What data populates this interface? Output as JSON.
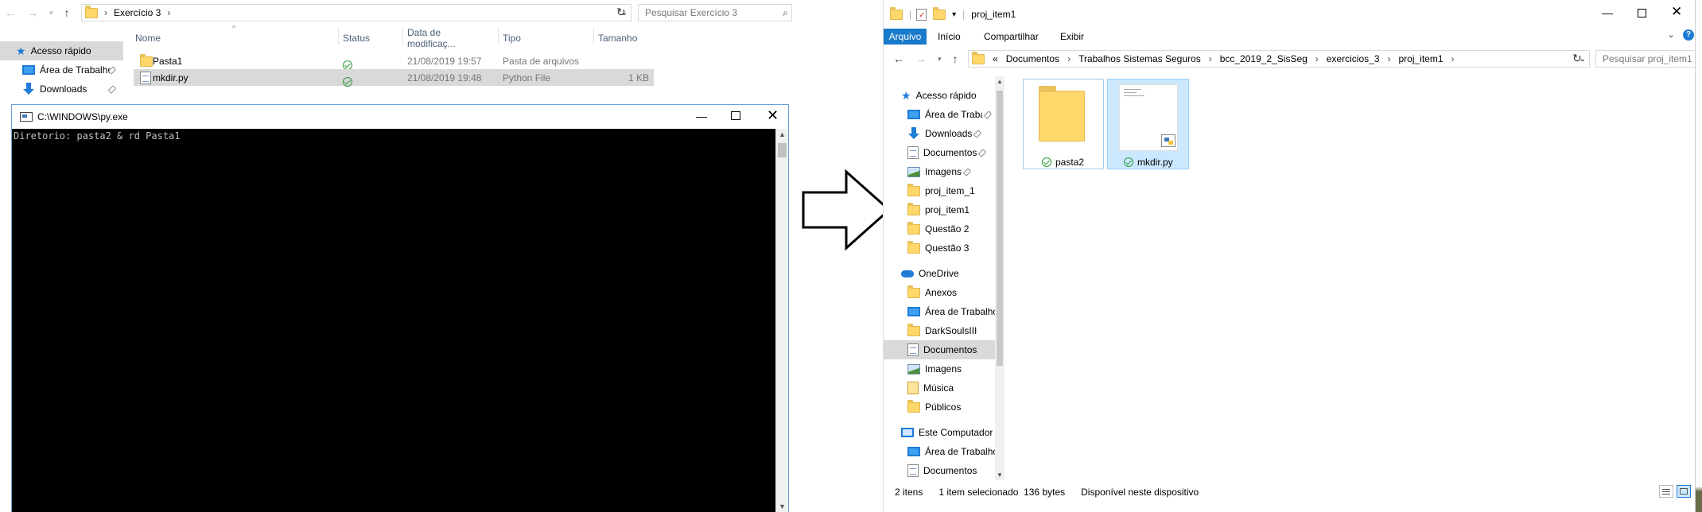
{
  "left_explorer": {
    "breadcrumb": [
      "Exercício 3"
    ],
    "search_placeholder": "Pesquisar Exercício 3",
    "columns": [
      "Nome",
      "Status",
      "Data de modificaç...",
      "Tipo",
      "Tamanho"
    ],
    "nav": [
      {
        "label": "Acesso rápido",
        "icon": "star-icon"
      },
      {
        "label": "Área de Trabalho",
        "icon": "desktop-icon"
      },
      {
        "label": "Downloads",
        "icon": "download-icon"
      }
    ],
    "files": [
      {
        "name": "Pasta1",
        "date": "21/08/2019 19:57",
        "type": "Pasta de arquivos",
        "size": ""
      },
      {
        "name": "mkdir.py",
        "date": "21/08/2019 19:48",
        "type": "Python File",
        "size": "1 KB"
      }
    ]
  },
  "console": {
    "title": "C:\\WINDOWS\\py.exe",
    "output": "Diretorio: pasta2 & rd Pasta1"
  },
  "right_explorer": {
    "title": "proj_item1",
    "ribbon_tabs": [
      "Arquivo",
      "Início",
      "Compartilhar",
      "Exibir"
    ],
    "breadcrumb": [
      "«",
      "Documentos",
      "Trabalhos Sistemas Seguros",
      "bcc_2019_2_SisSeg",
      "exercicios_3",
      "proj_item1"
    ],
    "search_placeholder": "Pesquisar proj_item1",
    "nav": [
      {
        "label": "Acesso rápido",
        "icon": "star-icon",
        "indent": 0
      },
      {
        "label": "Área de Traba",
        "icon": "desktop-icon",
        "indent": 1,
        "pinned": true
      },
      {
        "label": "Downloads",
        "icon": "download-icon",
        "indent": 1,
        "pinned": true
      },
      {
        "label": "Documentos",
        "icon": "documents-icon",
        "indent": 1,
        "pinned": true
      },
      {
        "label": "Imagens",
        "icon": "pictures-icon",
        "indent": 1,
        "pinned": true
      },
      {
        "label": "proj_item_1",
        "icon": "folder-icon",
        "indent": 1
      },
      {
        "label": "proj_item1",
        "icon": "folder-icon",
        "indent": 1
      },
      {
        "label": "Questão 2",
        "icon": "folder-icon",
        "indent": 1
      },
      {
        "label": "Questão 3",
        "icon": "folder-icon",
        "indent": 1
      },
      {
        "label": "OneDrive",
        "icon": "onedrive-icon",
        "indent": 0
      },
      {
        "label": "Anexos",
        "icon": "folder-icon",
        "indent": 1
      },
      {
        "label": "Área de Trabalho",
        "icon": "desktop-icon",
        "indent": 1
      },
      {
        "label": "DarkSoulsIII",
        "icon": "folder-icon",
        "indent": 1
      },
      {
        "label": "Documentos",
        "icon": "documents-icon",
        "indent": 1,
        "selected": true
      },
      {
        "label": "Imagens",
        "icon": "pictures-icon",
        "indent": 1
      },
      {
        "label": "Música",
        "icon": "music-icon",
        "indent": 1
      },
      {
        "label": "Públicos",
        "icon": "folder-icon",
        "indent": 1
      },
      {
        "label": "Este Computador",
        "icon": "computer-icon",
        "indent": 0
      },
      {
        "label": "Área de Trabalho",
        "icon": "desktop-icon",
        "indent": 1
      },
      {
        "label": "Documentos",
        "icon": "documents-icon",
        "indent": 1
      }
    ],
    "items": [
      {
        "name": "pasta2",
        "kind": "folder"
      },
      {
        "name": "mkdir.py",
        "kind": "python-file"
      }
    ],
    "status": {
      "count": "2 itens",
      "selection": "1 item selecionado  136 bytes",
      "availability": "Disponível neste dispositivo"
    }
  },
  "colors": {
    "accent": "#1e7bd6",
    "selection": "#cce8ff",
    "console_bg": "#000000"
  }
}
